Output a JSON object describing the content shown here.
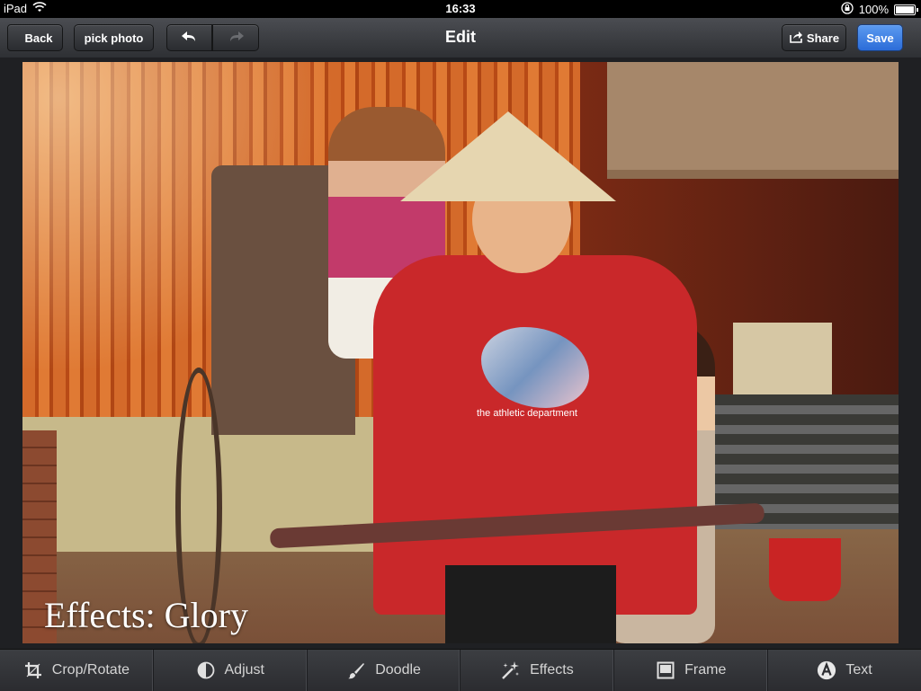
{
  "status_bar": {
    "device": "iPad",
    "time": "16:33",
    "battery": "100%",
    "battery_level": 1.0
  },
  "nav": {
    "back_label": "Back",
    "pick_photo_label": "pick photo",
    "title": "Edit",
    "share_label": "Share",
    "save_label": "Save"
  },
  "photo": {
    "effect_label": "Effects: Glory",
    "shirt_text": "the athletic department"
  },
  "toolbar": {
    "items": [
      {
        "label": "Crop/Rotate",
        "icon": "crop-icon"
      },
      {
        "label": "Adjust",
        "icon": "adjust-icon"
      },
      {
        "label": "Doodle",
        "icon": "brush-icon"
      },
      {
        "label": "Effects",
        "icon": "magic-wand-icon"
      },
      {
        "label": "Frame",
        "icon": "frame-icon"
      },
      {
        "label": "Text",
        "icon": "text-icon"
      }
    ]
  },
  "colors": {
    "save_accent": "#3a7be0",
    "toolbar_bg": "#2f3034"
  }
}
